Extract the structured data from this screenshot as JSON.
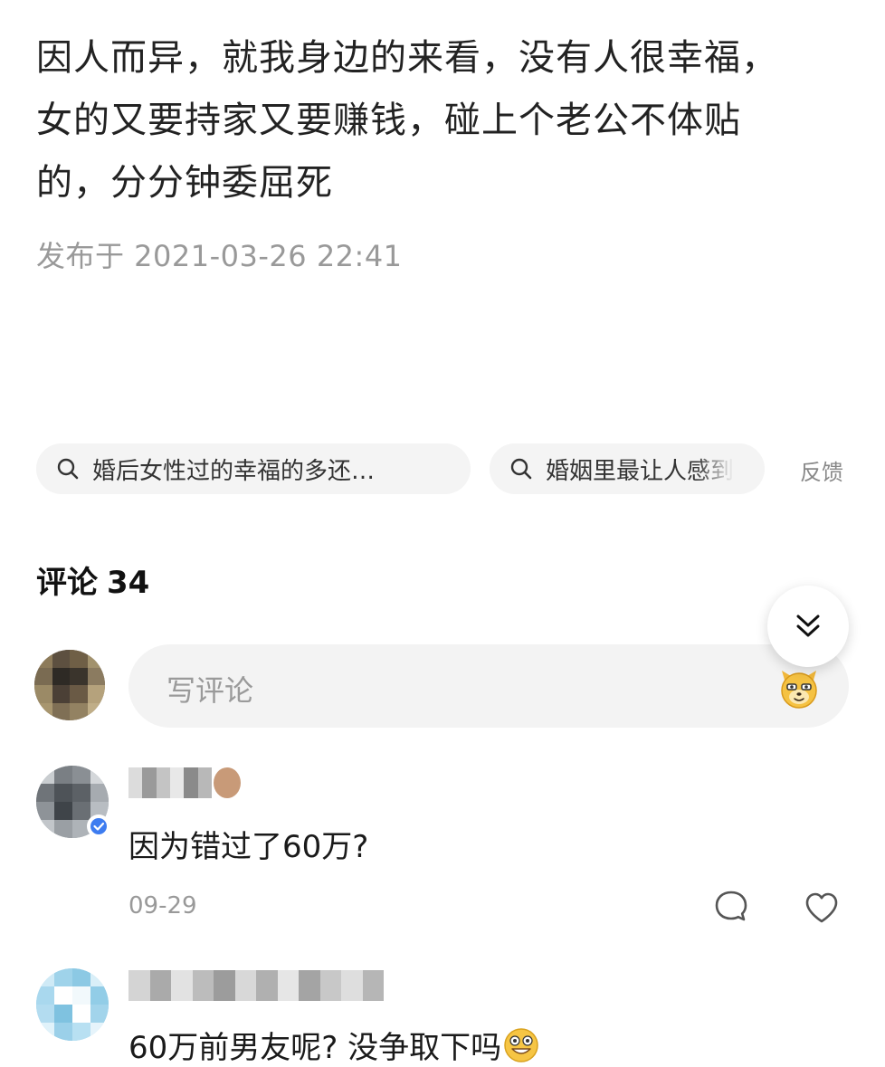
{
  "post": {
    "lines": [
      "因人而异，就我身边的来看，没有人很幸福，",
      "女的又要持家又要赚钱，碰上个老公不体贴",
      "的，分分钟委屈死"
    ],
    "published": "发布于 2021-03-26 22:41"
  },
  "related_searches": [
    {
      "label": "婚后女性过的幸福的多还…",
      "icon": "search-icon"
    },
    {
      "label": "婚姻里最让人感到",
      "icon": "search-icon"
    }
  ],
  "feedback_label": "反馈",
  "comments": {
    "title": "评论",
    "count": "34",
    "input_placeholder": "写评论",
    "collapse_icon": "double-chevron-down-icon",
    "emoji_icon": "dog-emoji-icon",
    "items": [
      {
        "text": "因为错过了60万?",
        "date": "09-29",
        "reply_icon": "comment-bubble-icon",
        "like_icon": "heart-outline-icon"
      },
      {
        "text": "60万前男友呢? 没争取下吗",
        "emoji": "grinning-emoji-icon"
      }
    ]
  },
  "colors": {
    "background": "#ffffff",
    "text": "#222222",
    "muted": "#999999",
    "chip_bg": "#f4f4f4",
    "input_bg": "#f3f3f3"
  }
}
